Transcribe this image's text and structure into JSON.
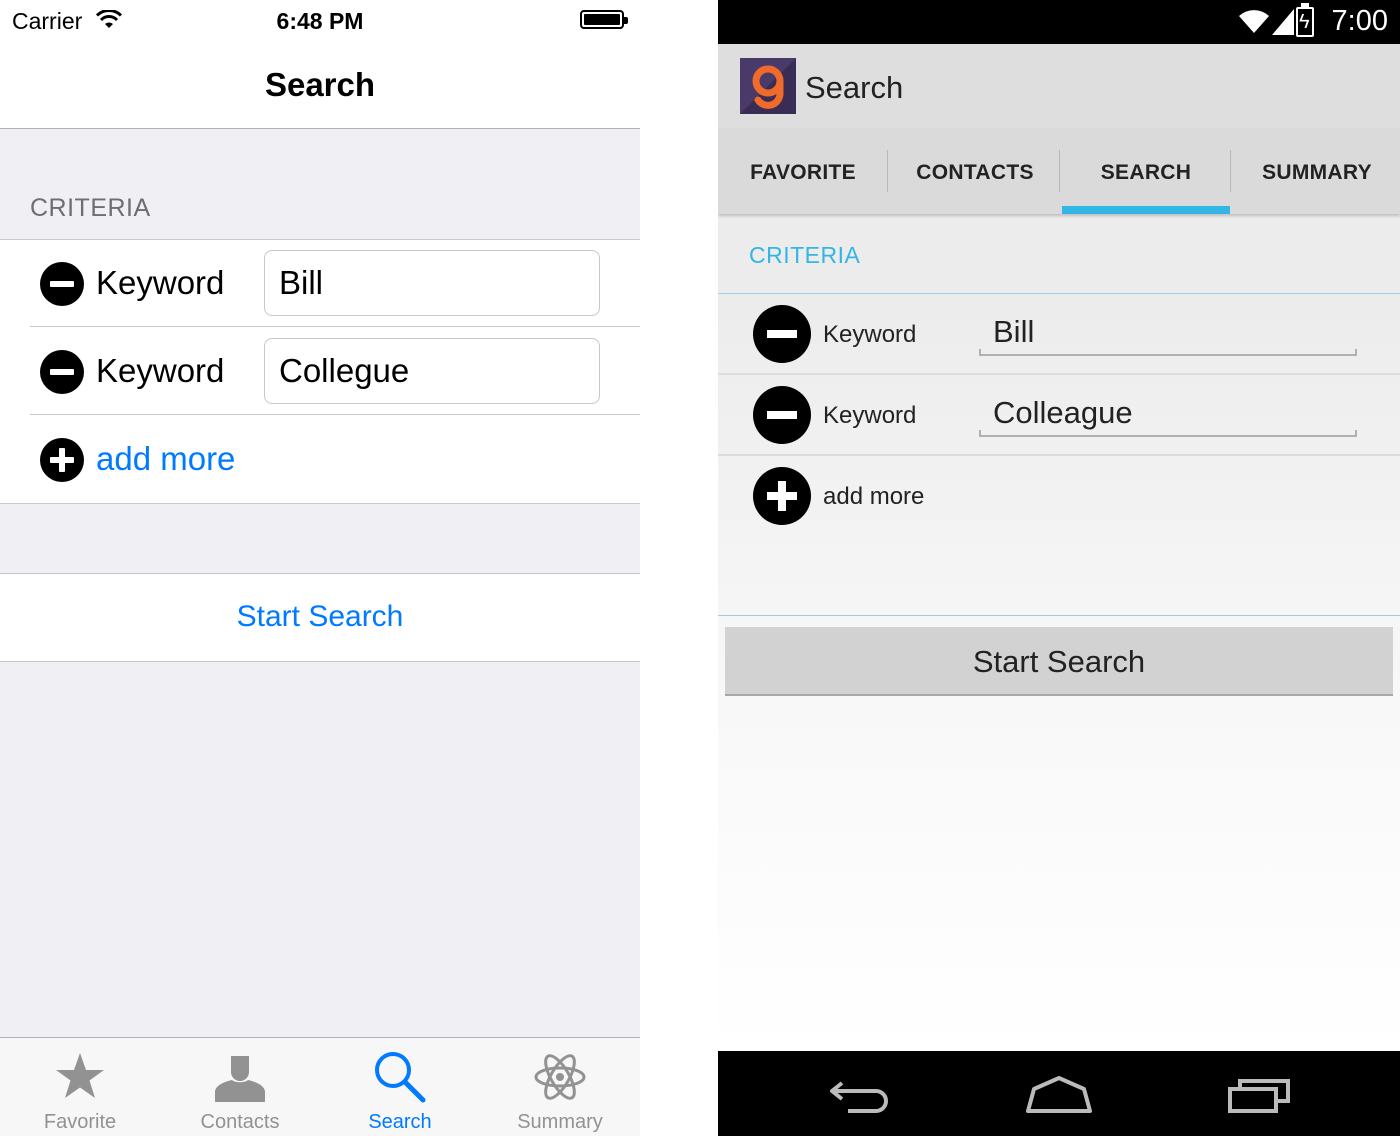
{
  "ios": {
    "status": {
      "carrier": "Carrier",
      "time": "6:48 PM"
    },
    "title": "Search",
    "criteria_header": "CRITERIA",
    "rows": [
      {
        "label": "Keyword",
        "value": "Bill"
      },
      {
        "label": "Keyword",
        "value": "Collegue"
      }
    ],
    "add_more": "add more",
    "start_search": "Start Search",
    "tabs": [
      {
        "label": "Favorite",
        "icon": "star-icon"
      },
      {
        "label": "Contacts",
        "icon": "person-icon"
      },
      {
        "label": "Search",
        "icon": "search-icon",
        "active": true
      },
      {
        "label": "Summary",
        "icon": "atom-icon"
      }
    ],
    "colors": {
      "accent": "#007aff",
      "background": "#efeff4"
    }
  },
  "android": {
    "status": {
      "time": "7:00"
    },
    "title": "Search",
    "tabs": [
      {
        "label": "FAVORITE"
      },
      {
        "label": "CONTACTS"
      },
      {
        "label": "SEARCH",
        "active": true
      },
      {
        "label": "SUMMARY"
      }
    ],
    "criteria_header": "CRITERIA",
    "rows": [
      {
        "label": "Keyword",
        "value": "Bill"
      },
      {
        "label": "Keyword",
        "value": "Colleague"
      }
    ],
    "add_more": "add more",
    "start_search": "Start Search",
    "colors": {
      "accent": "#33b5e5"
    }
  }
}
